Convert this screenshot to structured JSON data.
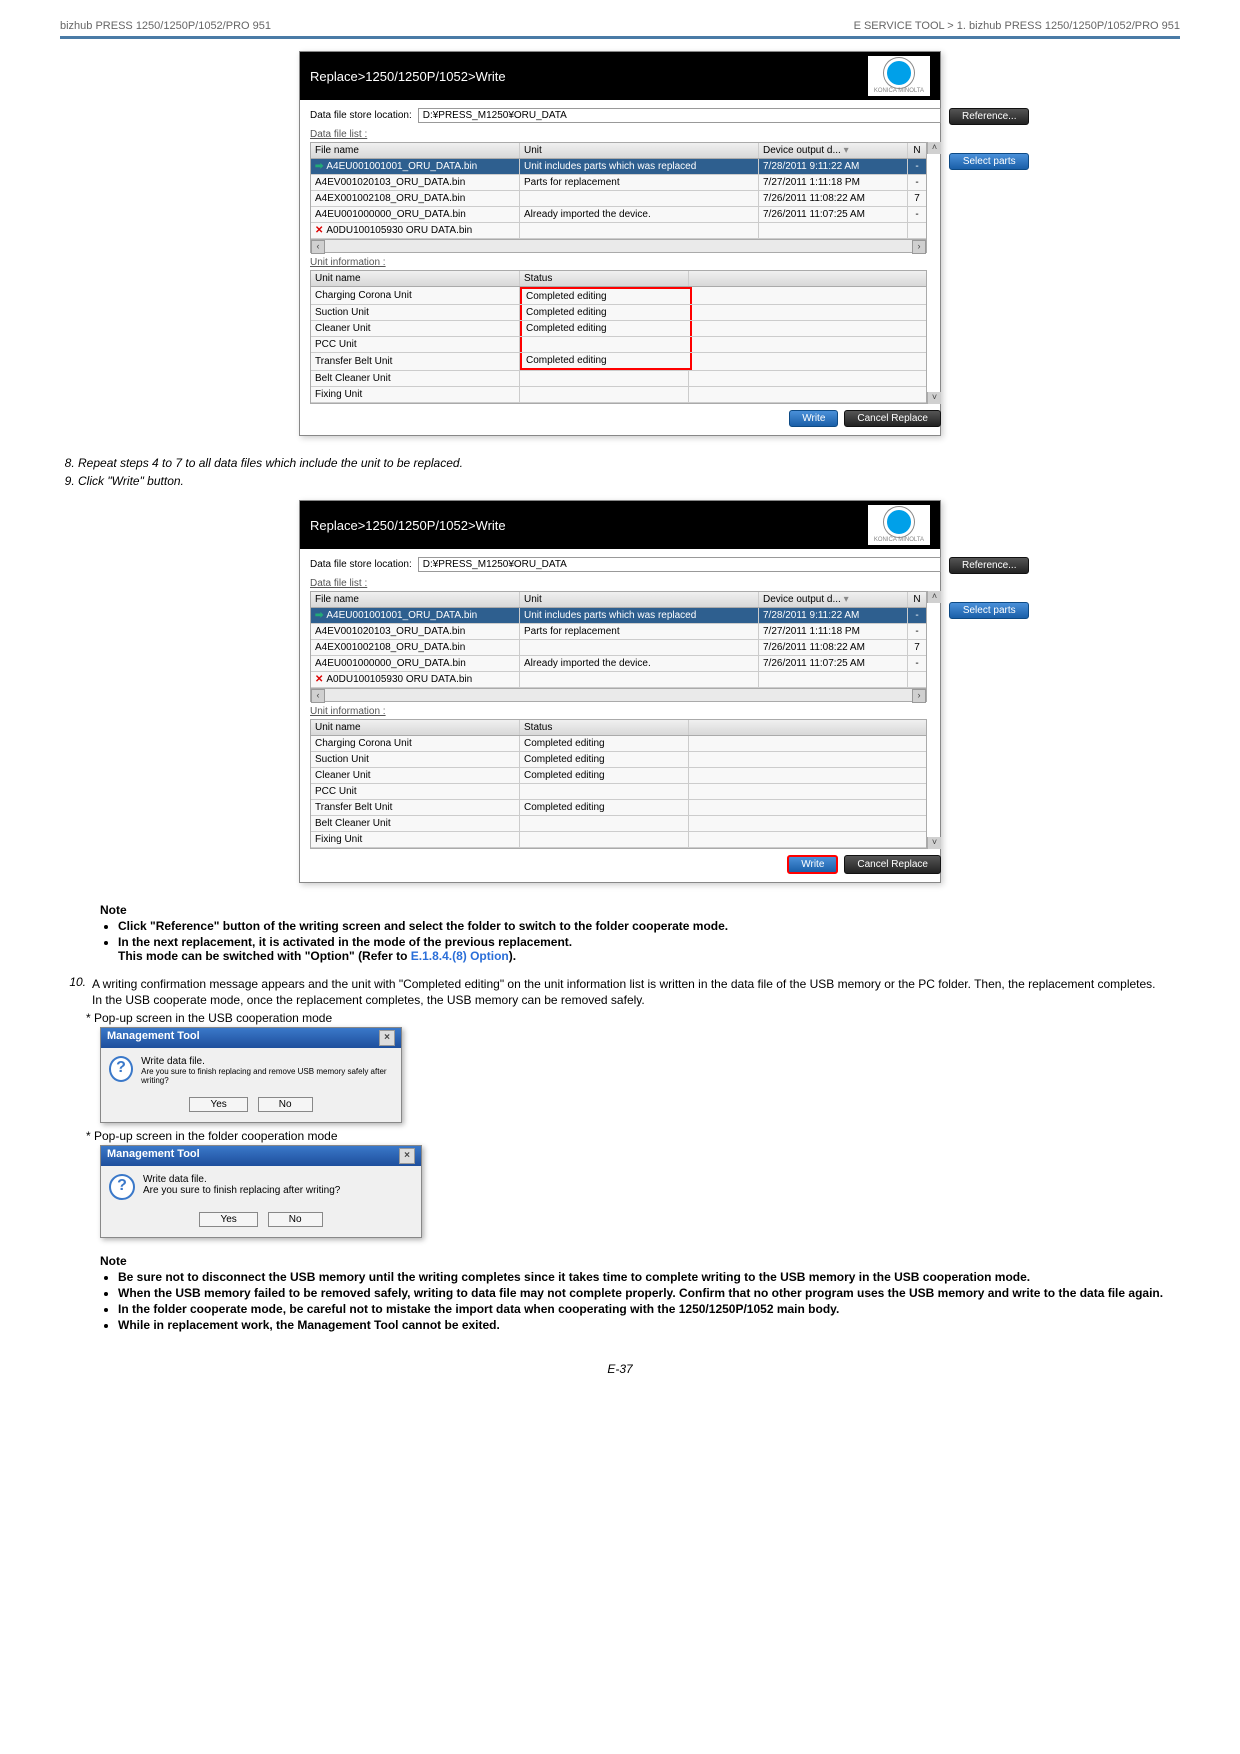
{
  "header": {
    "left": "bizhub PRESS 1250/1250P/1052/PRO 951",
    "right": "E SERVICE TOOL > 1.  bizhub PRESS 1250/1250P/1052/PRO 951"
  },
  "app": {
    "title": "Replace>1250/1250P/1052>Write",
    "logo_text": "KONICA MINOLTA",
    "store_label": "Data file store location:",
    "store_value": "D:¥PRESS_M1250¥ORU_DATA",
    "reference_btn": "Reference...",
    "data_file_list_label": "Data file list :",
    "select_parts_btn": "Select parts",
    "cols": {
      "file": "File name",
      "unit": "Unit",
      "output": "Device output d...",
      "n": "N"
    },
    "rows": [
      {
        "icon": "→",
        "file": "A4EU001001001_ORU_DATA.bin",
        "unit": "Unit includes parts which was replaced",
        "out": "7/28/2011 9:11:22 AM",
        "n": "-"
      },
      {
        "icon": "",
        "file": "A4EV001020103_ORU_DATA.bin",
        "unit": "Parts for replacement",
        "out": "7/27/2011 1:11:18 PM",
        "n": "-"
      },
      {
        "icon": "",
        "file": "A4EX001002108_ORU_DATA.bin",
        "unit": "",
        "out": "7/26/2011 11:08:22 AM",
        "n": "7"
      },
      {
        "icon": "",
        "file": "A4EU001000000_ORU_DATA.bin",
        "unit": "Already imported the device.",
        "out": "7/26/2011 11:07:25 AM",
        "n": "-"
      },
      {
        "icon": "✕",
        "file": "A0DU100105930 ORU DATA.bin",
        "unit": "",
        "out": "",
        "n": ""
      }
    ],
    "unit_info_label": "Unit information :",
    "ucols": {
      "name": "Unit name",
      "status": "Status"
    },
    "urows": [
      {
        "name": "Charging Corona Unit",
        "status": "Completed editing"
      },
      {
        "name": "Suction Unit",
        "status": "Completed editing"
      },
      {
        "name": "Cleaner Unit",
        "status": "Completed editing"
      },
      {
        "name": "PCC Unit",
        "status": ""
      },
      {
        "name": "Transfer Belt Unit",
        "status": "Completed editing"
      },
      {
        "name": "Belt Cleaner Unit",
        "status": ""
      },
      {
        "name": "Fixing Unit",
        "status": ""
      }
    ],
    "write_btn": "Write",
    "cancel_btn": "Cancel Replace"
  },
  "steps": {
    "s8": "Repeat steps 4 to 7 to all data files which include the unit to be replaced.",
    "s9": "Click \"Write\" button."
  },
  "note1": {
    "title": "Note",
    "b1": "Click \"Reference\" button of the writing screen and select the folder to switch to the folder cooperate mode.",
    "b2": "In the next replacement, it is activated in the mode of the previous replacement.",
    "b2b": "This mode can be switched with \"Option\" (Refer to ",
    "b2link": "E.1.8.4.(8) Option",
    "b2c": ")."
  },
  "step10": "A writing confirmation message appears and the unit with \"Completed editing\" on the unit information list is written in the data file of the USB memory or the PC folder. Then, the replacement completes.",
  "step10b": "In the USB cooperate mode, once the replacement completes, the USB memory can be removed safely.",
  "popup_usb_label": "* Pop-up screen in the USB cooperation mode",
  "popup_folder_label": "* Pop-up screen in the folder cooperation mode",
  "dialog": {
    "title": "Management Tool",
    "usb_msg1": "Write data file.",
    "usb_msg2": "Are you sure to finish replacing and remove USB memory safely after writing?",
    "folder_msg1": "Write data file.",
    "folder_msg2": "Are you sure to finish replacing after writing?",
    "yes": "Yes",
    "no": "No"
  },
  "note2": {
    "title": "Note",
    "b1": "Be sure not to disconnect the USB memory until the writing completes since it takes time to complete writing to the USB memory in the USB cooperation mode.",
    "b2": "When the USB memory failed to be removed safely, writing to data file may not complete properly. Confirm that no other program uses the USB memory and write to the data file again.",
    "b3": "In the folder cooperate mode, be careful not to mistake the import data when cooperating with the 1250/1250P/1052 main body.",
    "b4": "While in replacement work, the Management Tool cannot be exited."
  },
  "page_num": "E-37"
}
